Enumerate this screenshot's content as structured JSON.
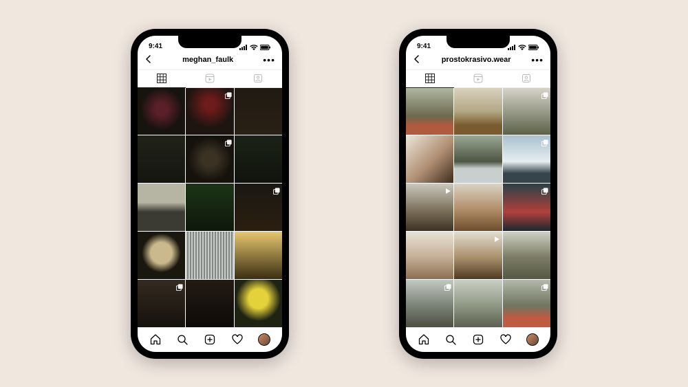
{
  "status_time": "9:41",
  "phones": [
    {
      "username": "meghan_faulk",
      "posts": [
        {
          "bg": "radial-gradient(circle at 50% 45%,#5a2028 0 18%,#17130e 60%)",
          "badge": null
        },
        {
          "bg": "radial-gradient(circle at 50% 35%,#6e1b1b 0 14%,#1e1510 60%)",
          "badge": "carousel"
        },
        {
          "bg": "linear-gradient(180deg,#201a13,#2a2014)",
          "badge": null
        },
        {
          "bg": "linear-gradient(180deg,#21231a,#14150f)",
          "badge": null
        },
        {
          "bg": "radial-gradient(circle at 50% 50%,#3b3223 0 22%,#15120c 65%)",
          "badge": "carousel"
        },
        {
          "bg": "linear-gradient(180deg,#1c2217,#10130c)",
          "badge": null
        },
        {
          "bg": "linear-gradient(180deg,#b6b4a2 40%,#3b3a33 60%)",
          "badge": null
        },
        {
          "bg": "linear-gradient(180deg,#1c3417,#0e170a)",
          "badge": null
        },
        {
          "bg": "linear-gradient(180deg,#1a1812,#2b1e10)",
          "badge": "carousel"
        },
        {
          "bg": "radial-gradient(circle at 50% 45%,#c9b98c 0 30%,#1a170e 55%)",
          "badge": null
        },
        {
          "bg": "repeating-linear-gradient(90deg,#caccc9 0 2px,#7e8582 2px 4px)",
          "badge": null
        },
        {
          "bg": "linear-gradient(180deg,#e8c770,#3a2d12)",
          "badge": null
        },
        {
          "bg": "linear-gradient(180deg,#352a20,#15110c)",
          "badge": "carousel"
        },
        {
          "bg": "linear-gradient(180deg,#221b14,#0d0a07)",
          "badge": null
        },
        {
          "bg": "radial-gradient(circle at 50% 40%,#e4d23a 0 26%,#1f2314 60%)",
          "badge": null
        }
      ]
    },
    {
      "username": "prostokrasivo.wear",
      "posts": [
        {
          "bg": "linear-gradient(180deg,#afb7a0,#6d6a4f 60%,#b05a3e 80%)",
          "badge": null
        },
        {
          "bg": "linear-gradient(180deg,#d9d2bf,#b3a784 50%,#7a5b2f 80%)",
          "badge": null
        },
        {
          "bg": "linear-gradient(180deg,#d6d4c9,#5c6249)",
          "badge": "carousel"
        },
        {
          "bg": "linear-gradient(135deg,#ece5d9,#b08f73 55%,#3e2c1d)",
          "badge": null
        },
        {
          "bg": "linear-gradient(180deg,#9ba893,#4d5543 55%,#c7cfcf 70%)",
          "badge": null
        },
        {
          "bg": "linear-gradient(180deg,#a9c1cf,#e6eef0 55%,#36444c 80%)",
          "badge": "carousel"
        },
        {
          "bg": "linear-gradient(180deg,#cbc7bd,#776b55 60%,#3d3325)",
          "badge": "video"
        },
        {
          "bg": "linear-gradient(180deg,#d9d3c4,#b08d69 55%,#6e4d2d)",
          "badge": null
        },
        {
          "bg": "linear-gradient(180deg,#2a4148,#b1403a 60%,#18292e)",
          "badge": "carousel"
        },
        {
          "bg": "linear-gradient(180deg,#e7e2d6,#c8b39b 50%,#8c6f52)",
          "badge": null
        },
        {
          "bg": "linear-gradient(180deg,#e3ddcf,#a98f6c 55%,#4f3a22)",
          "badge": "video"
        },
        {
          "bg": "linear-gradient(180deg,#cfd1c4,#7a7b62 55%,#555843)",
          "badge": null
        },
        {
          "bg": "linear-gradient(180deg,#c3c7c1,#7a8276 55%,#4e4f3f)",
          "badge": "carousel"
        },
        {
          "bg": "linear-gradient(180deg,#c9cfc4,#8f9784 55%,#5b6050)",
          "badge": null
        },
        {
          "bg": "linear-gradient(180deg,#b3b8a9,#6f7560 55%,#c05a40 80%)",
          "badge": "carousel"
        }
      ]
    }
  ]
}
